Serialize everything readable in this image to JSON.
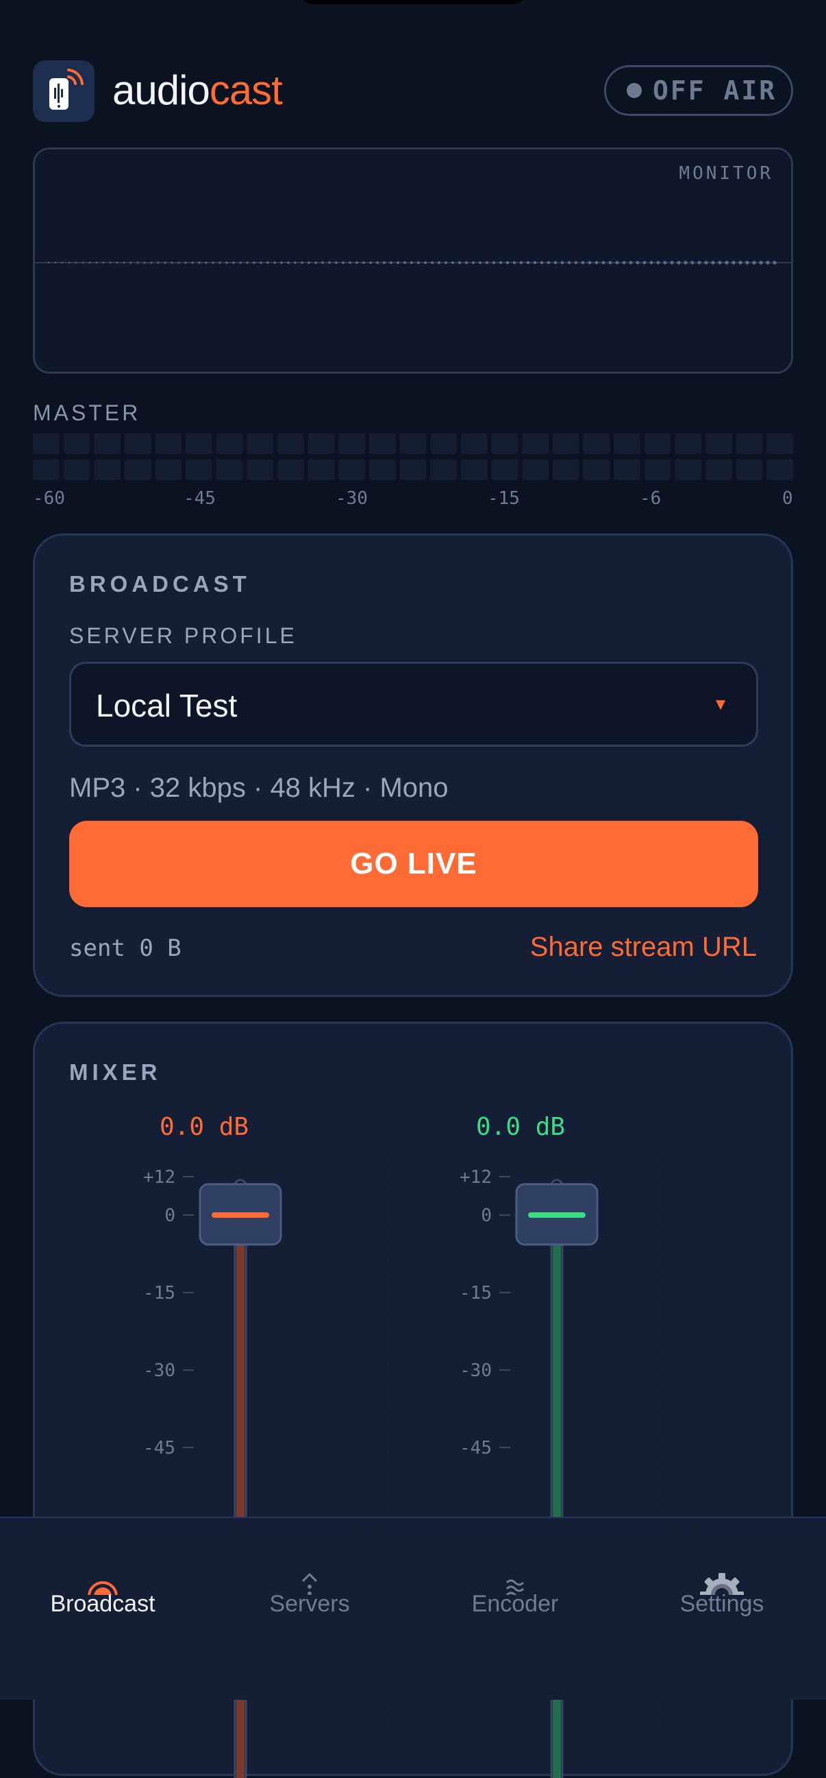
{
  "app": {
    "brand_part1": "audio",
    "brand_part2": "cast"
  },
  "status": {
    "label": "OFF AIR"
  },
  "monitor": {
    "label": "MONITOR"
  },
  "master": {
    "label": "MASTER",
    "level": 0,
    "scale": [
      "-60",
      "-45",
      "-30",
      "-15",
      "-6",
      "0"
    ]
  },
  "broadcast": {
    "title": "BROADCAST",
    "server_profile_label": "SERVER PROFILE",
    "server_profile_value": "Local Test",
    "specs": "MP3 · 32 kbps · 48 kHz · Mono",
    "go_live_label": "GO LIVE",
    "sent_label": "sent 0 B",
    "share_label": "Share stream URL"
  },
  "mixer": {
    "title": "MIXER",
    "channels": [
      {
        "gain_label": "0.0 dB",
        "gain_db": 0.0,
        "color": "#ff6b35",
        "scale": [
          "+12",
          "0",
          "-15",
          "-30",
          "-45"
        ]
      },
      {
        "gain_label": "0.0 dB",
        "gain_db": 0.0,
        "color": "#3ddc84",
        "scale": [
          "+12",
          "0",
          "-15",
          "-30",
          "-45"
        ]
      }
    ]
  },
  "nav": {
    "items": [
      {
        "label": "Broadcast",
        "icon": "record-icon",
        "active": true
      },
      {
        "label": "Servers",
        "icon": "upload-icon",
        "active": false
      },
      {
        "label": "Encoder",
        "icon": "waves-icon",
        "active": false
      },
      {
        "label": "Settings",
        "icon": "gear-icon",
        "active": false
      }
    ]
  },
  "colors": {
    "accent": "#ff6b35",
    "green": "#3ddc84",
    "background": "#0b1220",
    "card": "#141e35"
  }
}
